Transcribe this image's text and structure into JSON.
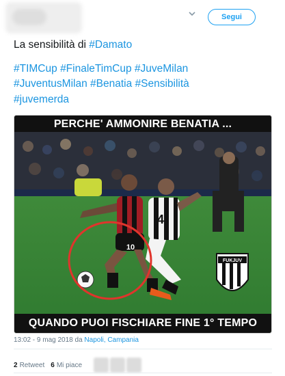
{
  "header": {
    "follow_label": "Segui"
  },
  "tweet": {
    "line1_prefix": "La sensibilità di ",
    "line1_tag": "#Damato",
    "tags_row1": [
      "#TIMCup",
      "#FinaleTimCup",
      "#JuveMilan"
    ],
    "tags_row2": [
      "#JuventusMilan",
      "#Benatia",
      "#Sensibilità"
    ],
    "tags_row3": [
      "#juvemerda"
    ]
  },
  "media": {
    "top_caption": "PERCHE' AMMONIRE BENATIA ...",
    "bottom_caption": "QUANDO PUOI FISCHIARE FINE  1° TEMPO",
    "player_number_red": "10",
    "player_number_white": "4",
    "badge_text": "FUKJUV"
  },
  "meta": {
    "time": "13:02 - 9 mag 2018 da ",
    "place": "Napoli, Campania"
  },
  "stats": {
    "retweets_count": "2",
    "retweets_label": "Retweet",
    "likes_count": "6",
    "likes_label": "Mi piace"
  },
  "colors": {
    "accent": "#1b95e0",
    "follow": "#1da1f2",
    "circle": "#e0342c"
  }
}
